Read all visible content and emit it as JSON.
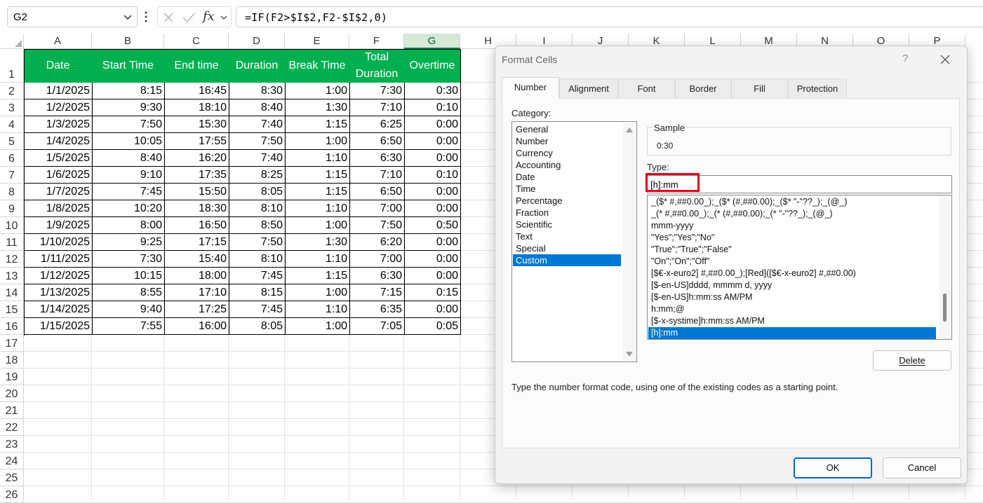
{
  "formula_bar": {
    "name_box": "G2",
    "fx_label": "fx",
    "formula": "=IF(F2>$I$2,F2-$I$2,0)"
  },
  "columns": [
    "A",
    "B",
    "C",
    "D",
    "E",
    "F",
    "G",
    "H",
    "I",
    "J",
    "K",
    "L",
    "M",
    "N",
    "O",
    "P"
  ],
  "rows": [
    "1",
    "2",
    "3",
    "4",
    "5",
    "6",
    "7",
    "8",
    "9",
    "10",
    "11",
    "12",
    "13",
    "14",
    "15",
    "16",
    "17",
    "18",
    "19",
    "20",
    "21",
    "22",
    "23",
    "24",
    "25",
    "26"
  ],
  "table": {
    "headers": [
      "Date",
      "Start Time",
      "End time",
      "Duration",
      "Break Time",
      "Total Duration",
      "Overtime"
    ],
    "rows": [
      [
        "1/1/2025",
        "8:15",
        "16:45",
        "8:30",
        "1:00",
        "7:30",
        "0:30"
      ],
      [
        "1/2/2025",
        "9:30",
        "18:10",
        "8:40",
        "1:30",
        "7:10",
        "0:10"
      ],
      [
        "1/3/2025",
        "7:50",
        "15:30",
        "7:40",
        "1:15",
        "6:25",
        "0:00"
      ],
      [
        "1/4/2025",
        "10:05",
        "17:55",
        "7:50",
        "1:00",
        "6:50",
        "0:00"
      ],
      [
        "1/5/2025",
        "8:40",
        "16:20",
        "7:40",
        "1:10",
        "6:30",
        "0:00"
      ],
      [
        "1/6/2025",
        "9:10",
        "17:35",
        "8:25",
        "1:15",
        "7:10",
        "0:10"
      ],
      [
        "1/7/2025",
        "7:45",
        "15:50",
        "8:05",
        "1:15",
        "6:50",
        "0:00"
      ],
      [
        "1/8/2025",
        "10:20",
        "18:30",
        "8:10",
        "1:10",
        "7:00",
        "0:00"
      ],
      [
        "1/9/2025",
        "8:00",
        "16:50",
        "8:50",
        "1:00",
        "7:50",
        "0:50"
      ],
      [
        "1/10/2025",
        "9:25",
        "17:15",
        "7:50",
        "1:30",
        "6:20",
        "0:00"
      ],
      [
        "1/11/2025",
        "7:30",
        "15:40",
        "8:10",
        "1:10",
        "7:00",
        "0:00"
      ],
      [
        "1/12/2025",
        "10:15",
        "18:00",
        "7:45",
        "1:15",
        "6:30",
        "0:00"
      ],
      [
        "1/13/2025",
        "8:55",
        "17:10",
        "8:15",
        "1:00",
        "7:15",
        "0:15"
      ],
      [
        "1/14/2025",
        "9:40",
        "17:25",
        "7:45",
        "1:10",
        "6:35",
        "0:00"
      ],
      [
        "1/15/2025",
        "7:55",
        "16:00",
        "8:05",
        "1:00",
        "7:05",
        "0:05"
      ]
    ]
  },
  "dialog": {
    "title": "Format Cells",
    "help": "?",
    "tabs": [
      "Number",
      "Alignment",
      "Font",
      "Border",
      "Fill",
      "Protection"
    ],
    "category_label": "Category:",
    "categories": [
      "General",
      "Number",
      "Currency",
      "Accounting",
      "Date",
      "Time",
      "Percentage",
      "Fraction",
      "Scientific",
      "Text",
      "Special",
      "Custom"
    ],
    "selected_category": "Custom",
    "sample_label": "Sample",
    "sample_value": "0:30",
    "type_label": "Type:",
    "type_value": "[h]:mm",
    "formats": [
      "_($* #,##0.00_);_($* (#,##0.00);_($* \"-\"??_);_(@_)",
      "_(* #,##0.00_);_(* (#,##0.00);_(* \"-\"??_);_(@_)",
      "mmm-yyyy",
      "\"Yes\";\"Yes\";\"No\"",
      "\"True\";\"True\";\"False\"",
      "\"On\";\"On\";\"Off\"",
      "[$€-x-euro2] #,##0.00_);[Red]([$€-x-euro2] #,##0.00)",
      "[$-en-US]dddd, mmmm d, yyyy",
      "[$-en-US]h:mm:ss AM/PM",
      "h:mm;@",
      "[$-x-systime]h:mm:ss AM/PM",
      "[h]:mm"
    ],
    "delete_label": "Delete",
    "hint": "Type the number format code, using one of the existing codes as a starting point.",
    "ok_label": "OK",
    "cancel_label": "Cancel"
  },
  "colors": {
    "header_fill": "#00b050",
    "selection_blue": "#0078d4",
    "highlight_red": "#e0001b"
  }
}
